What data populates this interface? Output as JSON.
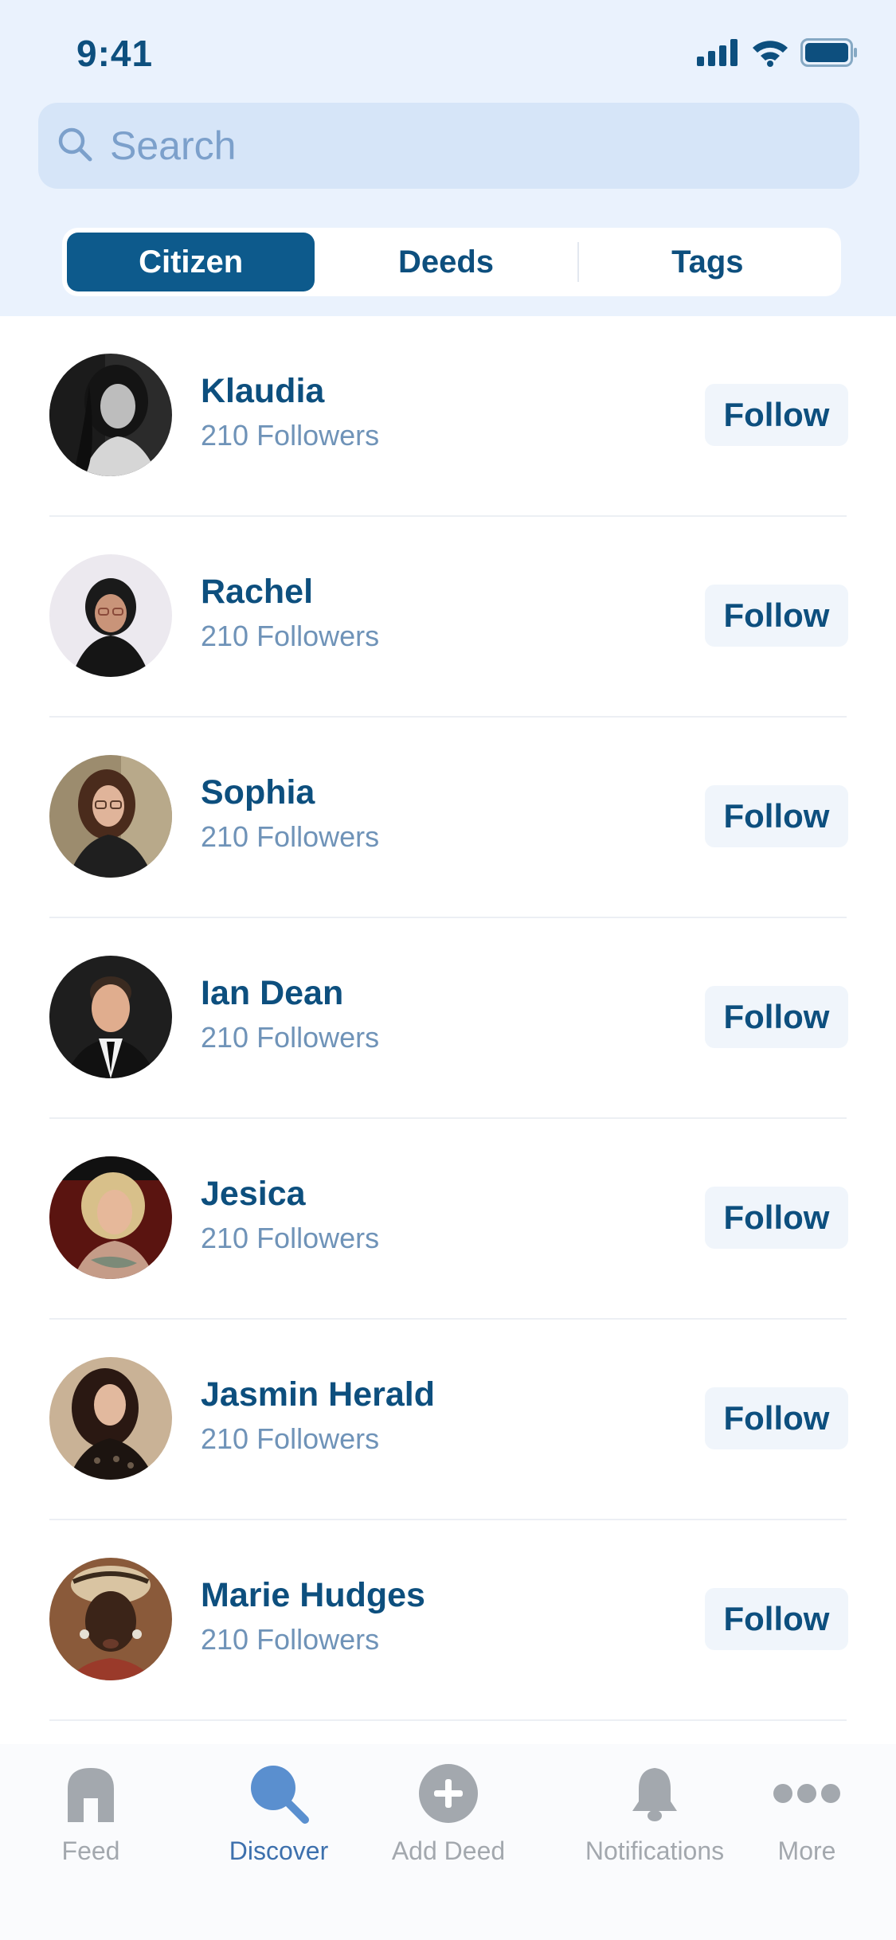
{
  "status_bar": {
    "time": "9:41",
    "icons": [
      "cellular-signal-icon",
      "wifi-icon",
      "battery-icon"
    ]
  },
  "search": {
    "placeholder": "Search",
    "value": "",
    "icon": "search-icon"
  },
  "segments": {
    "items": [
      {
        "label": "Citizen",
        "selected": true
      },
      {
        "label": "Deeds",
        "selected": false
      },
      {
        "label": "Tags",
        "selected": false
      }
    ]
  },
  "users": [
    {
      "name": "Klaudia",
      "followers": "210 Followers",
      "button": "Follow"
    },
    {
      "name": "Rachel",
      "followers": "210 Followers",
      "button": "Follow"
    },
    {
      "name": "Sophia",
      "followers": "210 Followers",
      "button": "Follow"
    },
    {
      "name": "Ian Dean",
      "followers": "210 Followers",
      "button": "Follow"
    },
    {
      "name": "Jesica",
      "followers": "210 Followers",
      "button": "Follow"
    },
    {
      "name": "Jasmin Herald",
      "followers": "210 Followers",
      "button": "Follow"
    },
    {
      "name": "Marie Hudges",
      "followers": "210 Followers",
      "button": "Follow"
    }
  ],
  "tabbar": {
    "items": [
      {
        "label": "Feed",
        "icon": "home-icon",
        "active": false
      },
      {
        "label": "Discover",
        "icon": "search-icon",
        "active": true
      },
      {
        "label": "Add Deed",
        "icon": "add-circle-icon",
        "active": false
      },
      {
        "label": "Notifications",
        "icon": "bell-icon",
        "active": false
      },
      {
        "label": "More",
        "icon": "more-dots-icon",
        "active": false
      }
    ]
  },
  "colors": {
    "primary": "#0d4f7e",
    "active_segment": "#0d5a8c",
    "header_bg": "#eaf2fd",
    "search_bg": "#d6e5f8",
    "secondary_text": "#6f93b8",
    "tab_inactive": "#a3a8ae",
    "tab_active": "#3d70ad"
  }
}
